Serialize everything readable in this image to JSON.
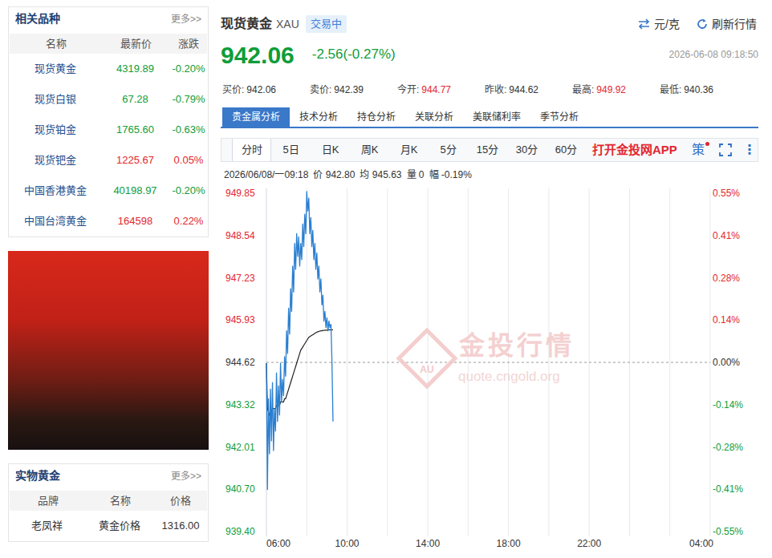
{
  "related": {
    "title": "相关品种",
    "more": "更多>>",
    "columns": [
      "名称",
      "最新价",
      "涨跌"
    ],
    "rows": [
      {
        "name": "现货黄金",
        "price": "4319.89",
        "change": "-0.20%",
        "color": "#0f9d3a"
      },
      {
        "name": "现货白银",
        "price": "67.28",
        "change": "-0.79%",
        "color": "#0f9d3a"
      },
      {
        "name": "现货铂金",
        "price": "1765.60",
        "change": "-0.63%",
        "color": "#0f9d3a"
      },
      {
        "name": "现货钯金",
        "price": "1225.67",
        "change": "0.05%",
        "color": "#e3262f"
      },
      {
        "name": "中国香港黄金",
        "price": "40198.97",
        "change": "-0.20%",
        "color": "#0f9d3a"
      },
      {
        "name": "中国台湾黄金",
        "price": "164598",
        "change": "0.22%",
        "color": "#e3262f"
      }
    ]
  },
  "physical": {
    "title": "实物黄金",
    "more": "更多>>",
    "columns": [
      "品牌",
      "名称",
      "价格"
    ],
    "rows": [
      {
        "brand": "老凤祥",
        "name": "黄金价格",
        "price": "1316.00"
      }
    ]
  },
  "quote": {
    "name": "现货黄金",
    "code": "XAU",
    "status": "交易中",
    "unit": "元/克",
    "refresh": "刷新行情",
    "price": "942.06",
    "change": "-2.56(-0.27%)",
    "color": "#0f9d3a",
    "time": "2026-06-08 09:18:50",
    "stats": [
      {
        "label": "买价:",
        "value": "942.06",
        "color": "#333333"
      },
      {
        "label": "卖价:",
        "value": "942.39",
        "color": "#333333"
      },
      {
        "label": "今开:",
        "value": "944.77",
        "color": "#e3262f"
      },
      {
        "label": "昨收:",
        "value": "944.62",
        "color": "#333333"
      },
      {
        "label": "最高:",
        "value": "949.92",
        "color": "#e3262f"
      },
      {
        "label": "最低:",
        "value": "940.36",
        "color": "#333333"
      }
    ]
  },
  "tabs": [
    {
      "label": "贵金属分析",
      "selected": true
    },
    {
      "label": "技术分析",
      "selected": false
    },
    {
      "label": "持仓分析",
      "selected": false
    },
    {
      "label": "关联分析",
      "selected": false
    },
    {
      "label": "美联储利率",
      "selected": false
    },
    {
      "label": "季节分析",
      "selected": false
    }
  ],
  "chart_tabs": [
    {
      "label": "分时",
      "selected": true
    },
    {
      "label": "5日",
      "selected": false
    },
    {
      "label": "日K",
      "selected": false
    },
    {
      "label": "周K",
      "selected": false
    },
    {
      "label": "月K",
      "selected": false
    },
    {
      "label": "5分",
      "selected": false
    },
    {
      "label": "15分",
      "selected": false
    },
    {
      "label": "30分",
      "selected": false
    },
    {
      "label": "60分",
      "selected": false
    }
  ],
  "toolbar": {
    "app": "打开金投网APP",
    "strategy": "策",
    "strategy_dot": true,
    "more": "⋮"
  },
  "chart": {
    "info": [
      "2026/06/08/一09:18",
      "价 942.80",
      "均 945.63",
      "量 0",
      "幅 -0.19%"
    ],
    "y_ticks": [
      {
        "price": "949.85",
        "pct": "0.55%",
        "color": "#e3262f"
      },
      {
        "price": "948.54",
        "pct": "0.41%",
        "color": "#e3262f"
      },
      {
        "price": "947.23",
        "pct": "0.28%",
        "color": "#e3262f"
      },
      {
        "price": "945.93",
        "pct": "0.14%",
        "color": "#e3262f"
      },
      {
        "price": "944.62",
        "pct": "0.00%",
        "color": "#333333"
      },
      {
        "price": "943.32",
        "pct": "-0.14%",
        "color": "#0f9d3a"
      },
      {
        "price": "942.01",
        "pct": "-0.28%",
        "color": "#0f9d3a"
      },
      {
        "price": "940.70",
        "pct": "-0.41%",
        "color": "#0f9d3a"
      },
      {
        "price": "939.40",
        "pct": "-0.55%",
        "color": "#0f9d3a"
      }
    ],
    "x_ticks": [
      "06:00",
      "10:00",
      "14:00",
      "18:00",
      "22:00",
      "04:00"
    ],
    "price_series": [
      944.6,
      940.7,
      943.5,
      941.8,
      943.8,
      942.2,
      944.0,
      941.9,
      943.2,
      942.5,
      944.3,
      942.8,
      943.9,
      943.0,
      944.6,
      943.4,
      944.1,
      943.6,
      944.8,
      944.2,
      945.6,
      944.9,
      946.3,
      945.5,
      946.9,
      946.2,
      947.6,
      946.8,
      948.3,
      947.5,
      948.6,
      947.9,
      948.5,
      947.6,
      948.3,
      947.8,
      948.9,
      948.2,
      949.2,
      948.6,
      949.9,
      949.3,
      949.7,
      948.6,
      949.1,
      948.2,
      948.7,
      947.8,
      948.3,
      947.5,
      948.0,
      947.2,
      947.6,
      946.8,
      947.2,
      946.4,
      946.7,
      945.9,
      946.2,
      945.7,
      946.0,
      945.6,
      945.9,
      945.7,
      945.8,
      944.6,
      942.8
    ],
    "average_series": [
      944.6,
      943.2,
      943.1,
      943.0,
      943.1,
      943.1,
      943.2,
      943.2,
      943.2,
      943.2,
      943.3,
      943.3,
      943.3,
      943.3,
      943.4,
      943.4,
      943.4,
      943.4,
      943.5,
      943.5,
      943.6,
      943.7,
      943.8,
      943.9,
      944.0,
      944.1,
      944.2,
      944.3,
      944.4,
      944.5,
      944.6,
      944.7,
      944.8,
      944.9,
      945.0,
      945.05,
      945.1,
      945.15,
      945.2,
      945.25,
      945.3,
      945.35,
      945.4,
      945.42,
      945.44,
      945.46,
      945.48,
      945.5,
      945.52,
      945.54,
      945.56,
      945.57,
      945.58,
      945.59,
      945.6,
      945.6,
      945.61,
      945.61,
      945.62,
      945.62,
      945.62,
      945.63,
      945.63,
      945.63,
      945.63,
      945.63,
      945.63
    ],
    "watermark": {
      "logo": "AU",
      "title": "金投行情",
      "url": "quote.cngold.org"
    }
  }
}
